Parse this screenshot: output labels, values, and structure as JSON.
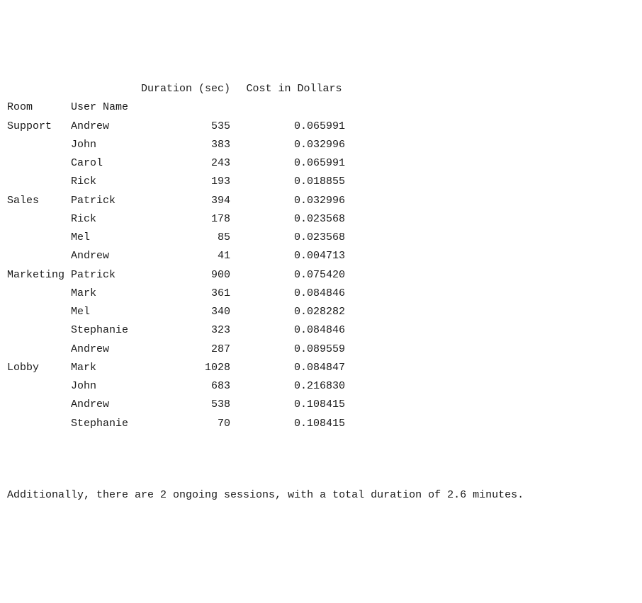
{
  "columns": {
    "duration": "Duration (sec)",
    "cost": "Cost in Dollars"
  },
  "index_names": {
    "room": "Room",
    "user": "User Name"
  },
  "rows": [
    {
      "room": "Support",
      "show_room": true,
      "user": "Andrew",
      "duration": "535",
      "cost": "0.065991"
    },
    {
      "room": "Support",
      "show_room": false,
      "user": "John",
      "duration": "383",
      "cost": "0.032996"
    },
    {
      "room": "Support",
      "show_room": false,
      "user": "Carol",
      "duration": "243",
      "cost": "0.065991"
    },
    {
      "room": "Support",
      "show_room": false,
      "user": "Rick",
      "duration": "193",
      "cost": "0.018855"
    },
    {
      "room": "Sales",
      "show_room": true,
      "user": "Patrick",
      "duration": "394",
      "cost": "0.032996"
    },
    {
      "room": "Sales",
      "show_room": false,
      "user": "Rick",
      "duration": "178",
      "cost": "0.023568"
    },
    {
      "room": "Sales",
      "show_room": false,
      "user": "Mel",
      "duration": "85",
      "cost": "0.023568"
    },
    {
      "room": "Sales",
      "show_room": false,
      "user": "Andrew",
      "duration": "41",
      "cost": "0.004713"
    },
    {
      "room": "Marketing",
      "show_room": true,
      "user": "Patrick",
      "duration": "900",
      "cost": "0.075420"
    },
    {
      "room": "Marketing",
      "show_room": false,
      "user": "Mark",
      "duration": "361",
      "cost": "0.084846"
    },
    {
      "room": "Marketing",
      "show_room": false,
      "user": "Mel",
      "duration": "340",
      "cost": "0.028282"
    },
    {
      "room": "Marketing",
      "show_room": false,
      "user": "Stephanie",
      "duration": "323",
      "cost": "0.084846"
    },
    {
      "room": "Marketing",
      "show_room": false,
      "user": "Andrew",
      "duration": "287",
      "cost": "0.089559"
    },
    {
      "room": "Lobby",
      "show_room": true,
      "user": "Mark",
      "duration": "1028",
      "cost": "0.084847"
    },
    {
      "room": "Lobby",
      "show_room": false,
      "user": "John",
      "duration": "683",
      "cost": "0.216830"
    },
    {
      "room": "Lobby",
      "show_room": false,
      "user": "Andrew",
      "duration": "538",
      "cost": "0.108415"
    },
    {
      "room": "Lobby",
      "show_room": false,
      "user": "Stephanie",
      "duration": "70",
      "cost": "0.108415"
    }
  ],
  "footer": "Additionally, there are 2 ongoing sessions, with a total duration of 2.6 minutes.",
  "chart_data": {
    "type": "table",
    "index": [
      "Room",
      "User Name"
    ],
    "columns": [
      "Duration (sec)",
      "Cost in Dollars"
    ],
    "data": [
      [
        "Support",
        "Andrew",
        535,
        0.065991
      ],
      [
        "Support",
        "John",
        383,
        0.032996
      ],
      [
        "Support",
        "Carol",
        243,
        0.065991
      ],
      [
        "Support",
        "Rick",
        193,
        0.018855
      ],
      [
        "Sales",
        "Patrick",
        394,
        0.032996
      ],
      [
        "Sales",
        "Rick",
        178,
        0.023568
      ],
      [
        "Sales",
        "Mel",
        85,
        0.023568
      ],
      [
        "Sales",
        "Andrew",
        41,
        0.004713
      ],
      [
        "Marketing",
        "Patrick",
        900,
        0.07542
      ],
      [
        "Marketing",
        "Mark",
        361,
        0.084846
      ],
      [
        "Marketing",
        "Mel",
        340,
        0.028282
      ],
      [
        "Marketing",
        "Stephanie",
        323,
        0.084846
      ],
      [
        "Marketing",
        "Andrew",
        287,
        0.089559
      ],
      [
        "Lobby",
        "Mark",
        1028,
        0.084847
      ],
      [
        "Lobby",
        "John",
        683,
        0.21683
      ],
      [
        "Lobby",
        "Andrew",
        538,
        0.108415
      ],
      [
        "Lobby",
        "Stephanie",
        70,
        0.108415
      ]
    ]
  }
}
